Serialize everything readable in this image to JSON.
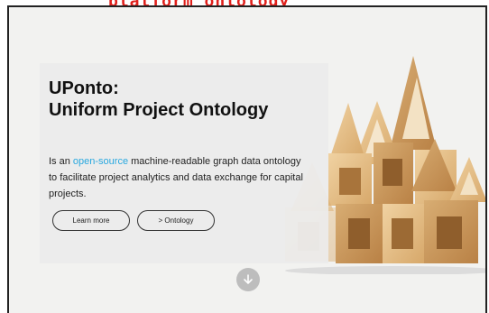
{
  "top_fragment": "platform ontology",
  "hero": {
    "title_line1": "UPonto:",
    "title_line2": "Uniform Project Ontology",
    "desc_prefix": "Is an ",
    "desc_link": "open-source",
    "desc_suffix": " machine-readable graph data ontology to facilitate project analytics and data exchange for capital projects."
  },
  "buttons": {
    "learn_more": "Learn more",
    "ontology": "> Ontology"
  },
  "icons": {
    "scroll_down": "arrow-down-icon"
  },
  "colors": {
    "link": "#29a8df",
    "overlay": "#ececec",
    "top_fragment": "#e0201b"
  }
}
